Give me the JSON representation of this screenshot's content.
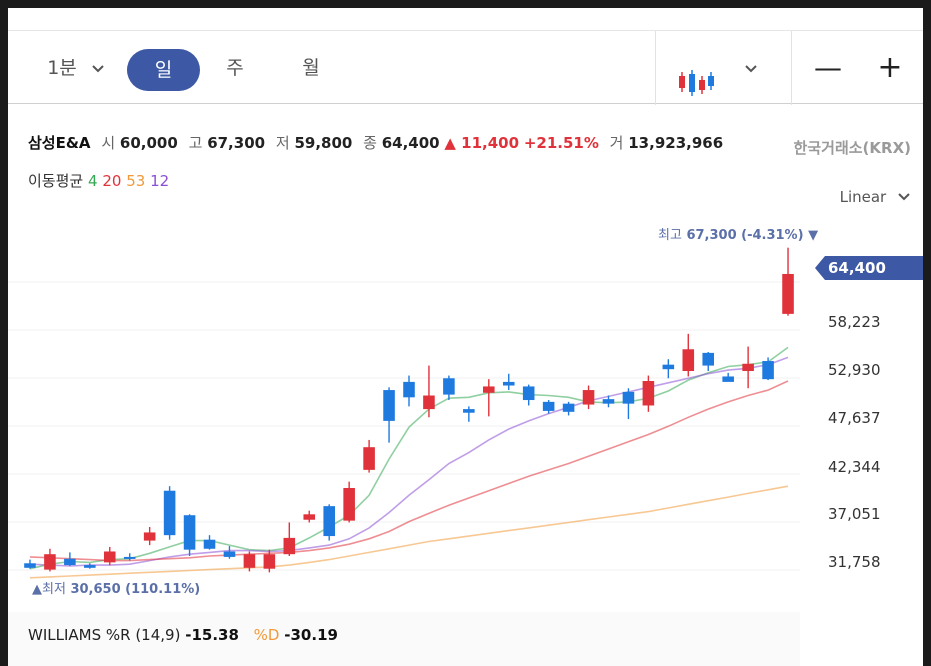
{
  "toolbar": {
    "interval_minute": "1분",
    "tabs": [
      "일",
      "주",
      "월"
    ],
    "active_tab": "일",
    "chart_type_icon": "candlestick-icon",
    "zoom_out": "—",
    "zoom_in": "+"
  },
  "quote": {
    "name": "삼성E&A",
    "open_label": "시",
    "open": "60,000",
    "high_label": "고",
    "high": "67,300",
    "low_label": "저",
    "low": "59,800",
    "close_label": "종",
    "close": "64,400",
    "change": "▲ 11,400",
    "change_pct": "+21.51%",
    "volume_label": "거",
    "volume": "13,923,966",
    "exchange": "한국거래소(KRX)"
  },
  "moving_average": {
    "label": "이동평균",
    "periods": [
      "4",
      "20",
      "53",
      "12"
    ],
    "colors": [
      "#34a853",
      "#e0323a",
      "#f09a3a",
      "#8b4fd6"
    ]
  },
  "scale_mode": "Linear",
  "y_axis": {
    "labels": [
      "58,223",
      "52,930",
      "47,637",
      "42,344",
      "37,051",
      "31,758"
    ],
    "last_price": "64,400"
  },
  "annotations": {
    "high_label": "최고",
    "high_value": "67,300 (-4.31%)",
    "low_label": "▲최저",
    "low_value": "30,650 (110.11%)"
  },
  "indicator": {
    "name": "WILLIAMS %R (14,9)",
    "r_value": "-15.38",
    "d_label": "%D",
    "d_value": "-30.19"
  },
  "chart_data": {
    "type": "candlestick",
    "up_color": "#e0323a",
    "down_color": "#1f7ae0",
    "ylim": [
      30000,
      68500
    ],
    "candles": [
      {
        "o": 32500,
        "h": 32900,
        "l": 31900,
        "c": 32000
      },
      {
        "o": 31800,
        "h": 34100,
        "l": 31600,
        "c": 33500
      },
      {
        "o": 33000,
        "h": 33700,
        "l": 32200,
        "c": 32300
      },
      {
        "o": 32300,
        "h": 32500,
        "l": 31900,
        "c": 32000
      },
      {
        "o": 32600,
        "h": 34300,
        "l": 32300,
        "c": 33800
      },
      {
        "o": 33200,
        "h": 33600,
        "l": 32800,
        "c": 33100
      },
      {
        "o": 35000,
        "h": 36500,
        "l": 34500,
        "c": 35900
      },
      {
        "o": 40500,
        "h": 41000,
        "l": 35100,
        "c": 35600
      },
      {
        "o": 37800,
        "h": 37900,
        "l": 33300,
        "c": 34000
      },
      {
        "o": 35100,
        "h": 35600,
        "l": 34000,
        "c": 34100
      },
      {
        "o": 33800,
        "h": 34400,
        "l": 33000,
        "c": 33200
      },
      {
        "o": 32000,
        "h": 33800,
        "l": 31600,
        "c": 33500
      },
      {
        "o": 31900,
        "h": 34000,
        "l": 31500,
        "c": 33500
      },
      {
        "o": 33500,
        "h": 37000,
        "l": 33300,
        "c": 35300
      },
      {
        "o": 37300,
        "h": 38300,
        "l": 37000,
        "c": 37900
      },
      {
        "o": 38800,
        "h": 39000,
        "l": 35000,
        "c": 35500
      },
      {
        "o": 37200,
        "h": 41500,
        "l": 37000,
        "c": 40800
      },
      {
        "o": 42800,
        "h": 46100,
        "l": 42500,
        "c": 45300
      },
      {
        "o": 51600,
        "h": 51900,
        "l": 45800,
        "c": 48200
      },
      {
        "o": 52500,
        "h": 53200,
        "l": 49800,
        "c": 50800
      },
      {
        "o": 49500,
        "h": 54300,
        "l": 48600,
        "c": 51000
      },
      {
        "o": 52900,
        "h": 53200,
        "l": 50500,
        "c": 51100
      },
      {
        "o": 49500,
        "h": 49800,
        "l": 48100,
        "c": 49100
      },
      {
        "o": 51300,
        "h": 52800,
        "l": 48700,
        "c": 52000
      },
      {
        "o": 52500,
        "h": 53400,
        "l": 51600,
        "c": 52100
      },
      {
        "o": 52000,
        "h": 52200,
        "l": 49900,
        "c": 50500
      },
      {
        "o": 50300,
        "h": 50500,
        "l": 49000,
        "c": 49300
      },
      {
        "o": 50100,
        "h": 50300,
        "l": 48800,
        "c": 49200
      },
      {
        "o": 50000,
        "h": 52100,
        "l": 49500,
        "c": 51600
      },
      {
        "o": 50600,
        "h": 51000,
        "l": 49700,
        "c": 50100
      },
      {
        "o": 51400,
        "h": 51800,
        "l": 48400,
        "c": 50100
      },
      {
        "o": 49900,
        "h": 53200,
        "l": 49200,
        "c": 52600
      },
      {
        "o": 54400,
        "h": 55000,
        "l": 52900,
        "c": 53900
      },
      {
        "o": 53700,
        "h": 57800,
        "l": 53100,
        "c": 56100
      },
      {
        "o": 55700,
        "h": 55800,
        "l": 53700,
        "c": 54300
      },
      {
        "o": 53100,
        "h": 53500,
        "l": 52600,
        "c": 52500
      },
      {
        "o": 53700,
        "h": 56400,
        "l": 51800,
        "c": 54500
      },
      {
        "o": 54800,
        "h": 55200,
        "l": 52700,
        "c": 52800
      },
      {
        "o": 60000,
        "h": 67300,
        "l": 59800,
        "c": 64400
      }
    ],
    "ma": [
      {
        "period": "4",
        "color": "#34a853",
        "values": [
          31900,
          32400,
          32700,
          32600,
          32900,
          33000,
          33600,
          34300,
          35000,
          35000,
          34500,
          34000,
          33900,
          34200,
          35300,
          36500,
          37800,
          40000,
          44000,
          47500,
          49500,
          50700,
          50800,
          51300,
          51400,
          51100,
          51000,
          50800,
          50300,
          50200,
          50300,
          50700,
          51500,
          52700,
          53500,
          54200,
          54400,
          54700,
          56300
        ]
      },
      {
        "period": "12",
        "color": "#8b4fd6",
        "values": [
          32400,
          32300,
          32200,
          32300,
          32300,
          32400,
          32800,
          33200,
          33500,
          33700,
          33900,
          33900,
          33800,
          33900,
          34200,
          34500,
          35200,
          36400,
          38100,
          40000,
          41700,
          43500,
          44700,
          46100,
          47300,
          48200,
          49000,
          49700,
          50400,
          50900,
          51400,
          51900,
          52400,
          52900,
          53400,
          53800,
          54000,
          54400,
          55200
        ]
      },
      {
        "period": "20",
        "color": "#e0323a",
        "values": [
          33200,
          33100,
          33000,
          32900,
          32800,
          32800,
          32900,
          33000,
          33100,
          33300,
          33400,
          33500,
          33600,
          33700,
          33900,
          34200,
          34600,
          35200,
          36000,
          37100,
          38000,
          38900,
          39700,
          40500,
          41300,
          42100,
          42800,
          43500,
          44300,
          45100,
          45900,
          46700,
          47600,
          48600,
          49500,
          50300,
          51000,
          51600,
          52600
        ]
      },
      {
        "period": "53",
        "color": "#f09a3a",
        "values": [
          30900,
          31000,
          31100,
          31200,
          31300,
          31400,
          31500,
          31600,
          31700,
          31800,
          31900,
          32000,
          32100,
          32300,
          32600,
          32900,
          33300,
          33700,
          34100,
          34500,
          34900,
          35200,
          35500,
          35800,
          36100,
          36400,
          36700,
          37000,
          37300,
          37600,
          37900,
          38200,
          38600,
          39000,
          39400,
          39800,
          40200,
          40600,
          41000
        ]
      }
    ]
  }
}
